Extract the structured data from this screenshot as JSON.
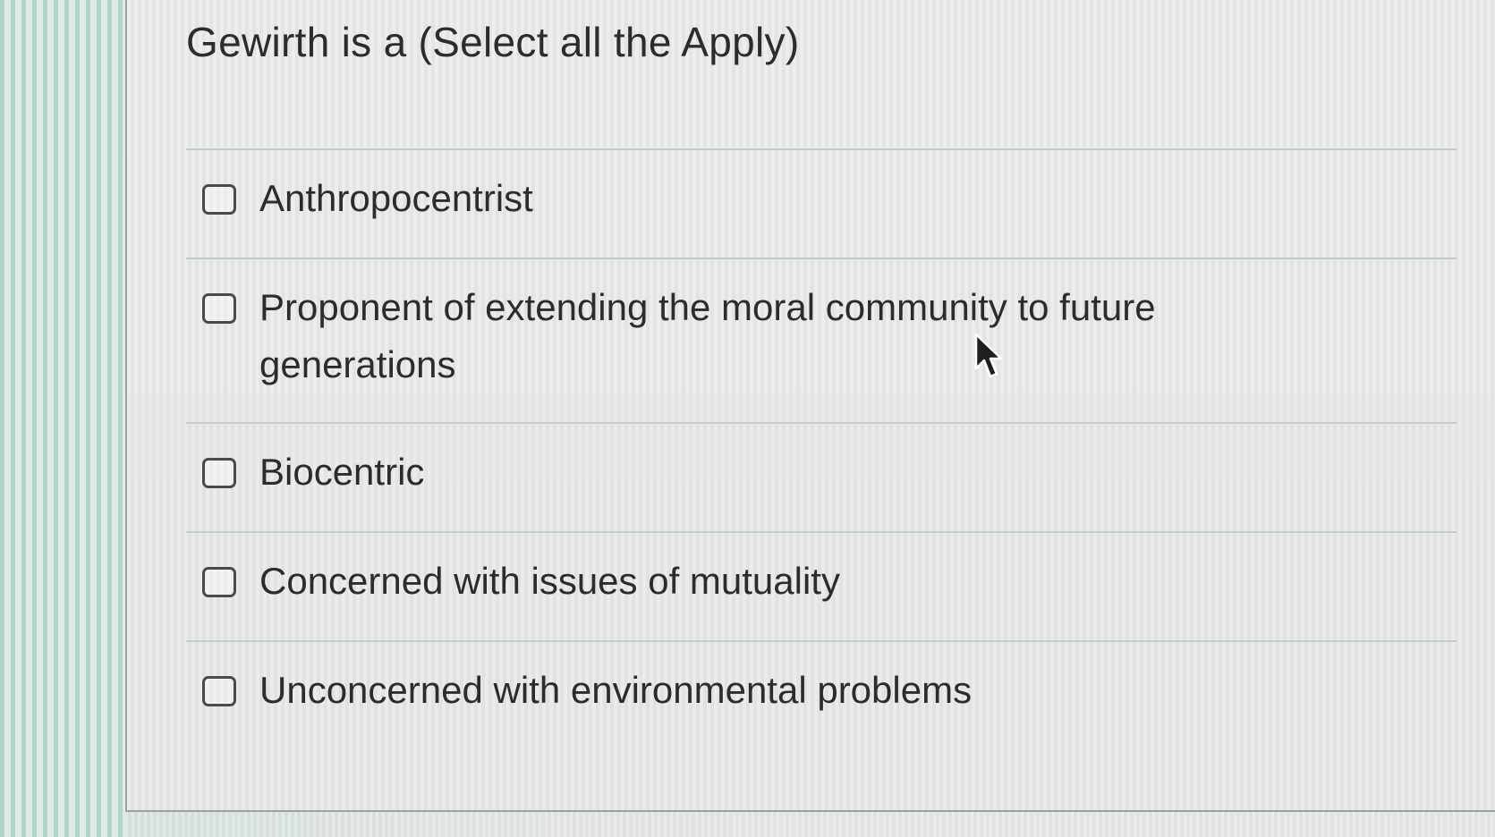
{
  "question": {
    "title": "Gewirth is a (Select all the Apply)"
  },
  "options": [
    {
      "label": "Anthropocentrist",
      "checked": false
    },
    {
      "label": "Proponent of extending the moral community to future generations",
      "checked": false
    },
    {
      "label": "Biocentric",
      "checked": false
    },
    {
      "label": "Concerned with issues of mutuality",
      "checked": false
    },
    {
      "label": "Unconcerned with environmental problems",
      "checked": false
    }
  ],
  "icons": {
    "pointer": "mouse-pointer-icon"
  }
}
